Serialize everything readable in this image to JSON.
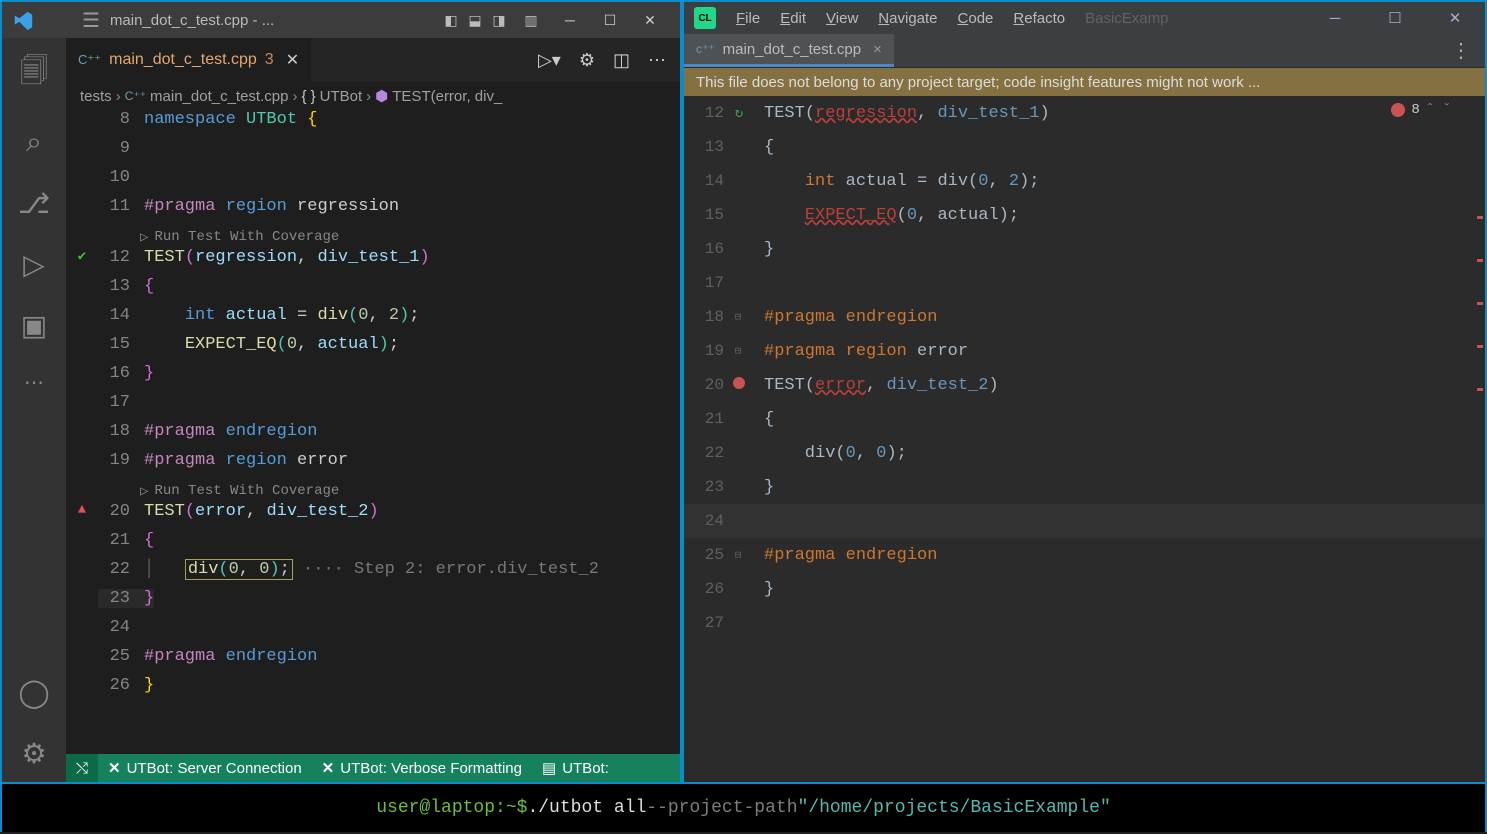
{
  "vscode": {
    "window_title": "main_dot_c_test.cpp - ...",
    "tab": {
      "filename": "main_dot_c_test.cpp",
      "problems": "3"
    },
    "breadcrumb": [
      "tests",
      "main_dot_c_test.cpp",
      "UTBot",
      "TEST(error, div_"
    ],
    "status": {
      "server": "UTBot: Server Connection",
      "verbose": "UTBot: Verbose Formatting",
      "more": "UTBot:"
    },
    "lens_text": "Run Test With Coverage",
    "lines": {
      "l8": "namespace UTBot {",
      "l11": "#pragma region regression",
      "l12": "TEST(regression, div_test_1)",
      "l13": "{",
      "l14": "    int actual = div(0, 2);",
      "l15": "    EXPECT_EQ(0, actual);",
      "l16": "}",
      "l18": "#pragma endregion",
      "l19": "#pragma region error",
      "l20": "TEST(error, div_test_2)",
      "l21": "{",
      "l22a": "div(0, 0);",
      "l22b": " ···· Step 2: error.div_test_2",
      "l23": "}",
      "l25": "#pragma endregion",
      "l26": "}"
    },
    "line_numbers": [
      "8",
      "9",
      "10",
      "11",
      "12",
      "13",
      "14",
      "15",
      "16",
      "17",
      "18",
      "19",
      "20",
      "21",
      "22",
      "23",
      "24",
      "25",
      "26"
    ]
  },
  "clion": {
    "menus": [
      "File",
      "Edit",
      "View",
      "Navigate",
      "Code",
      "Refacto"
    ],
    "project_hint": "BasicExamp",
    "tab_filename": "main_dot_c_test.cpp",
    "banner": "This file does not belong to any project target; code insight features might not work ...",
    "problem_count": "8",
    "lines": {
      "l12": "TEST(regression, div_test_1)",
      "l13": "{",
      "l14": "    int actual = div(0, 2);",
      "l15": "    EXPECT_EQ(0, actual);",
      "l16": "}",
      "l18": "#pragma endregion",
      "l19": "#pragma region error",
      "l20": "TEST(error, div_test_2)",
      "l21": "{",
      "l22": "    div(0, 0);",
      "l23": "}",
      "l25": "#pragma endregion",
      "l26": "}"
    },
    "line_numbers": [
      "12",
      "13",
      "14",
      "15",
      "16",
      "17",
      "18",
      "19",
      "20",
      "21",
      "22",
      "23",
      "24",
      "25",
      "26",
      "27"
    ]
  },
  "terminal": {
    "prompt": "user@laptop:~$ ",
    "cmd": "./utbot all ",
    "flag": "--project-path ",
    "path": "\"/home/projects/BasicExample\""
  }
}
